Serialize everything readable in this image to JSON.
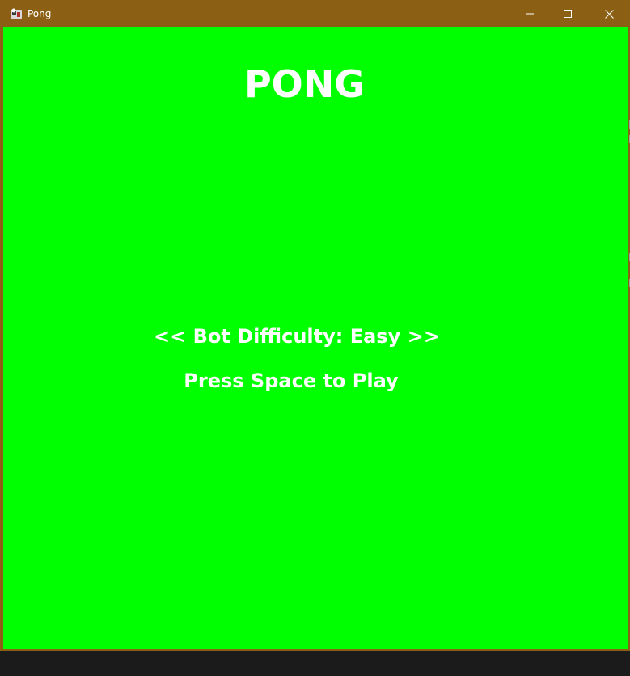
{
  "window": {
    "title": "Pong",
    "titlebar_color": "#8b5f14",
    "controls": {
      "minimize_icon": "minimize-icon",
      "maximize_icon": "maximize-icon",
      "close_icon": "close-icon"
    }
  },
  "game": {
    "background_color": "#00ff00",
    "text_color": "#ffffff",
    "title": "PONG",
    "difficulty_label": "<< Bot Difficulty: Easy >>",
    "start_prompt": "Press Space to Play"
  }
}
